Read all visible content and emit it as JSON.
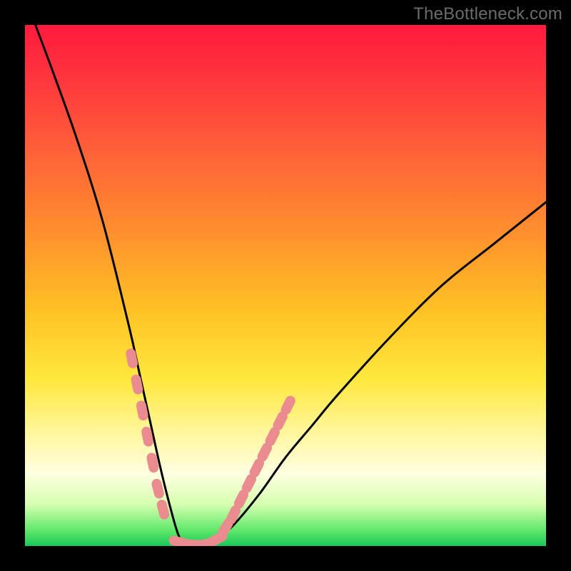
{
  "watermark": "TheBottleneck.com",
  "colors": {
    "frame_bg": "#000000",
    "gradient_top": "#ff1a3c",
    "gradient_mid1": "#ff8a2f",
    "gradient_mid2": "#ffe83d",
    "gradient_mid3": "#ffffe0",
    "gradient_bottom": "#18c85a",
    "curve": "#000000",
    "marker": "#e98b8f"
  },
  "chart_data": {
    "type": "line",
    "title": "",
    "xlabel": "",
    "ylabel": "",
    "xlim": [
      0,
      100
    ],
    "ylim": [
      0,
      100
    ],
    "grid": false,
    "legend": false,
    "series": [
      {
        "name": "bottleneck-curve",
        "x": [
          2,
          5,
          10,
          15,
          20,
          22,
          24,
          26,
          28,
          29.5,
          31,
          33,
          35,
          37,
          40,
          45,
          50,
          55,
          60,
          70,
          80,
          90,
          100
        ],
        "y": [
          100,
          92,
          78,
          62,
          42,
          33,
          24,
          15,
          7,
          2,
          0,
          0,
          0,
          1.5,
          4,
          10,
          17,
          23,
          29,
          40,
          50,
          58,
          66
        ]
      },
      {
        "name": "markers-left",
        "x": [
          20.5,
          21.5,
          22.5,
          23.5,
          24.5,
          25.5,
          26.5
        ],
        "y": [
          36,
          31,
          26,
          21,
          16,
          11,
          7
        ]
      },
      {
        "name": "markers-bottom",
        "x": [
          29.5,
          31,
          32.5,
          34,
          35.5,
          37
        ],
        "y": [
          0.8,
          0.4,
          0.2,
          0.2,
          0.6,
          1.4
        ]
      },
      {
        "name": "markers-right",
        "x": [
          38.5,
          40,
          41.5,
          43,
          44.5,
          46,
          47.5,
          49,
          50.5
        ],
        "y": [
          3.5,
          6,
          9,
          12,
          15,
          18,
          21,
          24,
          27
        ]
      }
    ]
  }
}
